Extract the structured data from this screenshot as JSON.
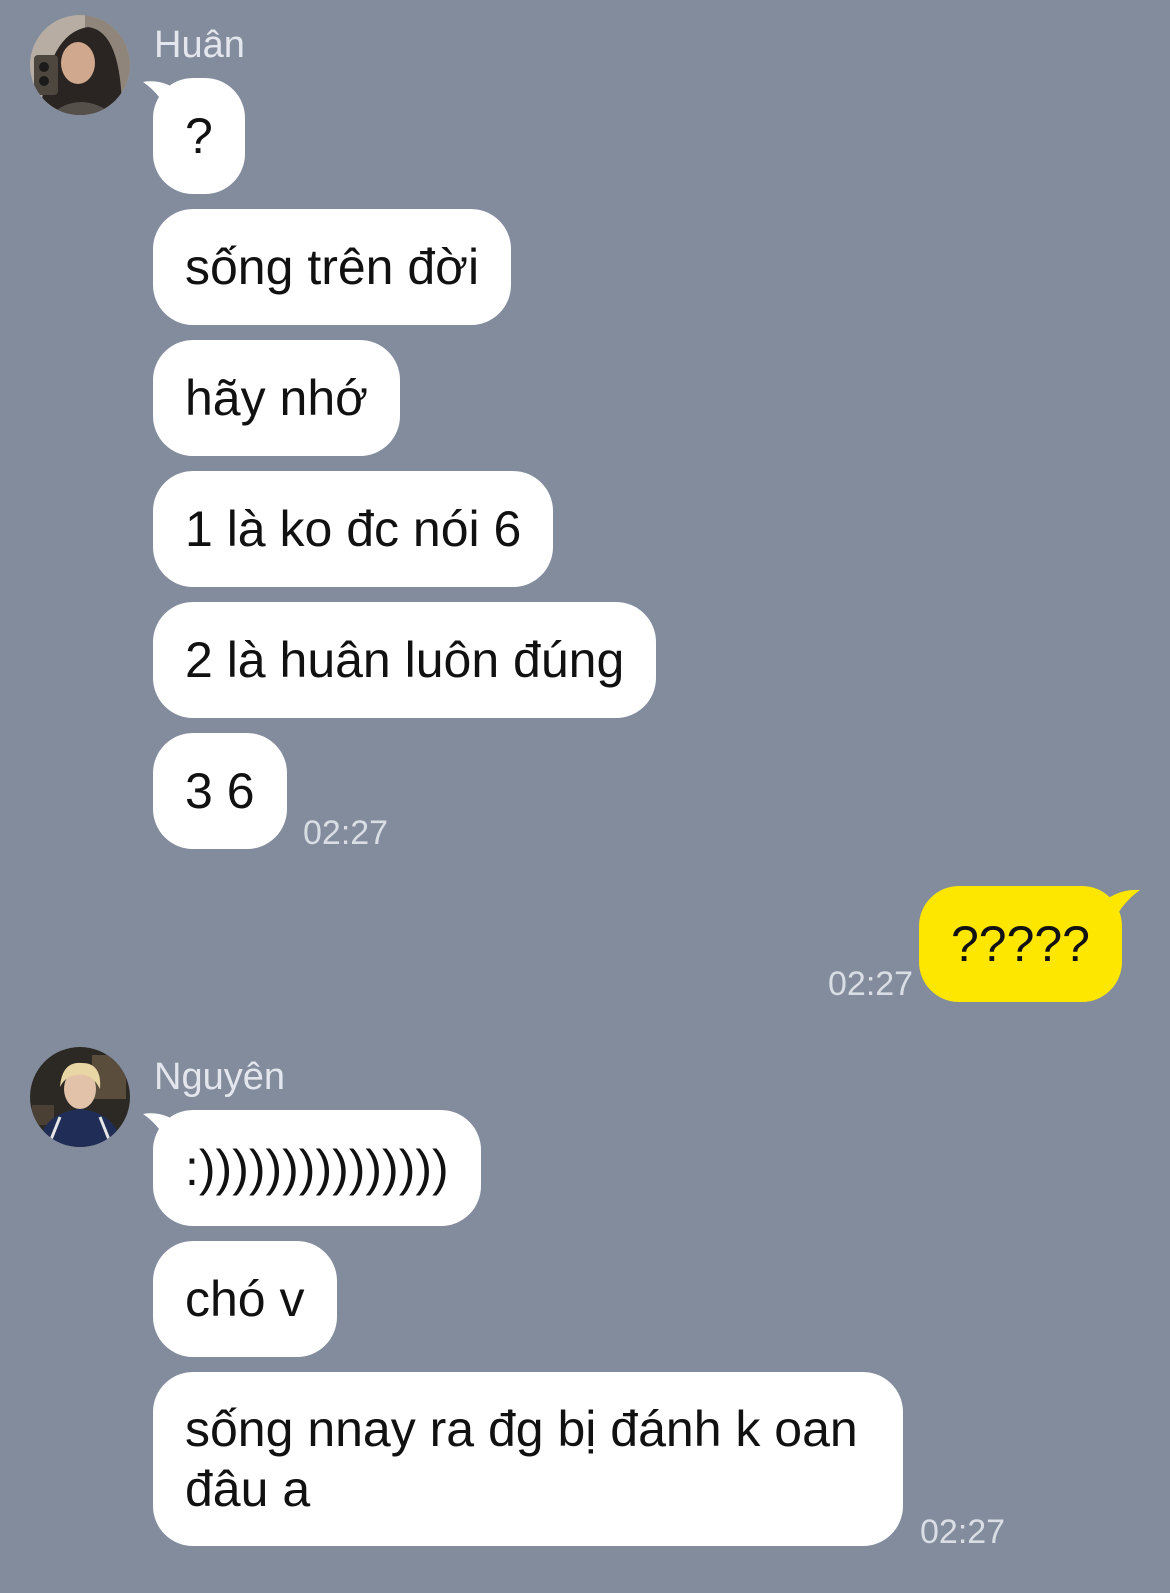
{
  "colors": {
    "background": "#838c9d",
    "incoming_bubble": "#ffffff",
    "outgoing_bubble": "#fde600",
    "meta_text": "#e3e6ec"
  },
  "threads": [
    {
      "sender": "Huân",
      "messages": [
        "?",
        "sống trên đời",
        "hãy nhớ",
        "1 là ko đc nói 6",
        "2 là huân luôn đúng",
        "3 6"
      ],
      "time": "02:27"
    },
    {
      "outgoing": true,
      "messages": [
        "?????"
      ],
      "time": "02:27"
    },
    {
      "sender": "Nguyên",
      "messages": [
        ":)))))))))))))))",
        "chó v",
        "sống nnay ra đg bị đánh k oan đâu a"
      ],
      "time": "02:27"
    }
  ]
}
